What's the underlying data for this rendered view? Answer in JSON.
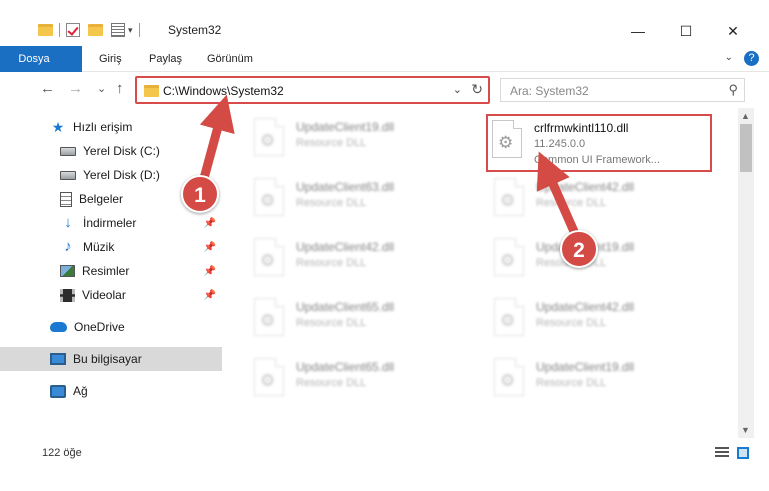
{
  "window": {
    "title": "System32",
    "minimize_glyph": "—",
    "maximize_glyph": "☐",
    "close_glyph": "✕"
  },
  "ribbon": {
    "tabs": [
      "Dosya",
      "Giriş",
      "Paylaş",
      "Görünüm"
    ],
    "expand_glyph": "⌄",
    "help_glyph": "?"
  },
  "navigation": {
    "back_glyph": "←",
    "forward_glyph": "→",
    "recent_glyph": "⌄",
    "up_glyph": "↑",
    "address": "C:\\Windows\\System32",
    "dropdown_glyph": "⌄",
    "refresh_glyph": "↻",
    "search_placeholder": "Ara: System32",
    "search_glyph": "⚲"
  },
  "sidebar": {
    "items": [
      {
        "label": "Hızlı erişim",
        "icon": "star-icon"
      },
      {
        "label": "Yerel Disk (C:)",
        "icon": "disk-icon"
      },
      {
        "label": "Yerel Disk (D:)",
        "icon": "disk-icon"
      },
      {
        "label": "Belgeler",
        "icon": "documents-icon",
        "pinned": true
      },
      {
        "label": "İndirmeler",
        "icon": "download-icon",
        "pinned": true
      },
      {
        "label": "Müzik",
        "icon": "music-icon",
        "pinned": true
      },
      {
        "label": "Resimler",
        "icon": "pictures-icon",
        "pinned": true
      },
      {
        "label": "Videolar",
        "icon": "videos-icon",
        "pinned": true
      },
      {
        "label": "OneDrive",
        "icon": "cloud-icon"
      },
      {
        "label": "Bu bilgisayar",
        "icon": "computer-icon",
        "selected": true
      },
      {
        "label": "Ağ",
        "icon": "network-icon"
      }
    ],
    "pin_glyph": "📌"
  },
  "files": [
    {
      "name": "UpdateClient19.dll",
      "desc": "Resource DLL"
    },
    {
      "name": "crlfrmwkintl110.dll",
      "version": "11.245.0.0",
      "desc": "Common UI Framework...",
      "highlighted": true
    },
    {
      "name": "UpdateClient63.dll",
      "desc": "Resource DLL"
    },
    {
      "name": "UpdateClient42.dll",
      "desc": "Resource DLL"
    },
    {
      "name": "UpdateClient42.dll",
      "desc": "Resource DLL"
    },
    {
      "name": "UpdateClient19.dll",
      "desc": "Resource DLL"
    },
    {
      "name": "UpdateClient65.dll",
      "desc": "Resource DLL"
    },
    {
      "name": "UpdateClient42.dll",
      "desc": "Resource DLL"
    },
    {
      "name": "UpdateClient65.dll",
      "desc": "Resource DLL"
    },
    {
      "name": "UpdateClient19.dll",
      "desc": "Resource DLL"
    }
  ],
  "status": {
    "item_count": "122 öğe"
  },
  "annotations": {
    "step1": "1",
    "step2": "2"
  },
  "colors": {
    "accent": "#1a6fc2",
    "highlight": "#d94a4a",
    "selection": "#d9d9d9"
  }
}
